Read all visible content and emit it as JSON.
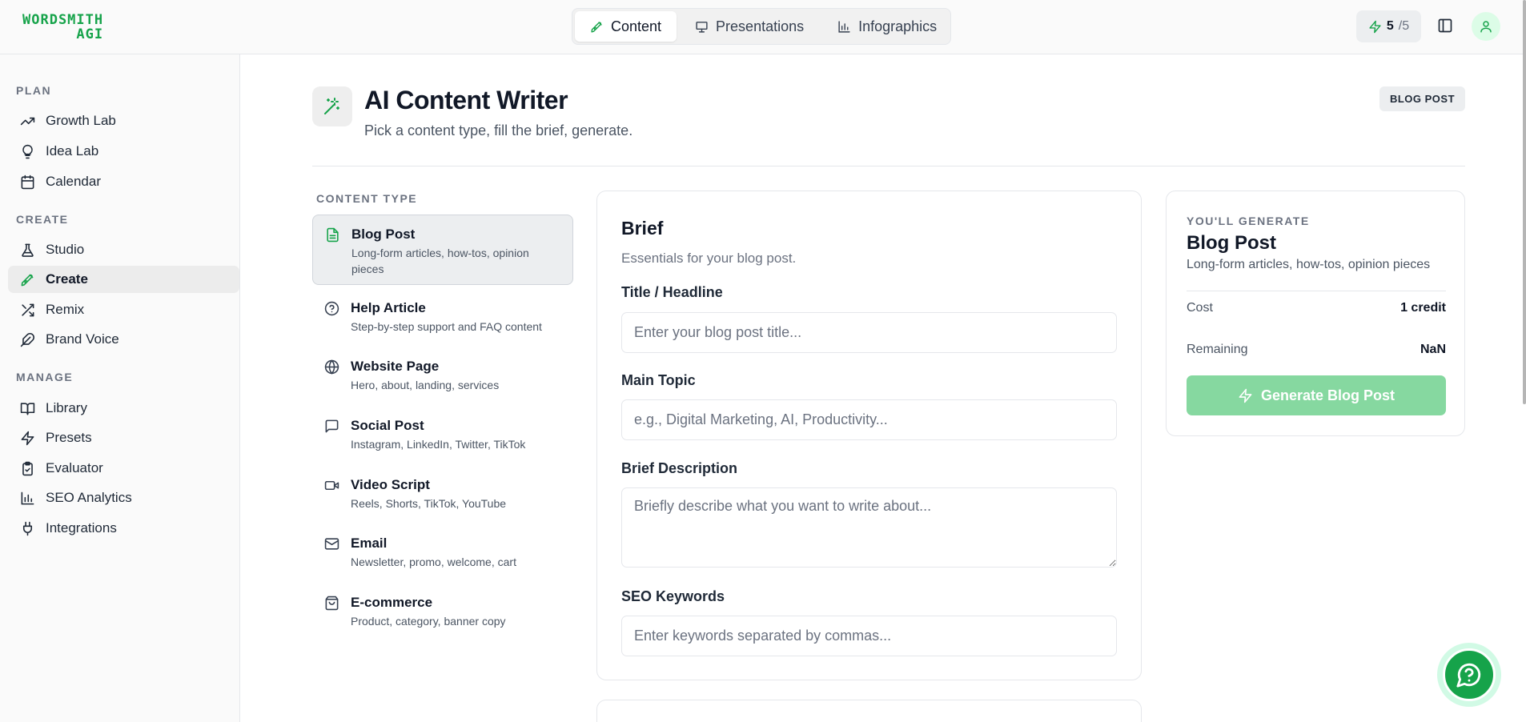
{
  "brand": {
    "line1": "WORDSMITH",
    "line2": "AGI",
    "color": "#16a34a"
  },
  "topnav": {
    "tabs": [
      {
        "label": "Content",
        "icon": "pen-nib-icon",
        "active": true
      },
      {
        "label": "Presentations",
        "icon": "presentation-icon",
        "active": false
      },
      {
        "label": "Infographics",
        "icon": "bar-chart-icon",
        "active": false
      }
    ],
    "credits": {
      "current": "5",
      "total": "/5"
    }
  },
  "sidebar": {
    "sections": [
      {
        "label": "PLAN",
        "items": [
          {
            "label": "Growth Lab",
            "icon": "trending-up-icon"
          },
          {
            "label": "Idea Lab",
            "icon": "lightbulb-icon"
          },
          {
            "label": "Calendar",
            "icon": "calendar-icon"
          }
        ]
      },
      {
        "label": "CREATE",
        "items": [
          {
            "label": "Studio",
            "icon": "flask-icon"
          },
          {
            "label": "Create",
            "icon": "pen-nib-icon",
            "active": true
          },
          {
            "label": "Remix",
            "icon": "shuffle-icon"
          },
          {
            "label": "Brand Voice",
            "icon": "feather-icon"
          }
        ]
      },
      {
        "label": "MANAGE",
        "items": [
          {
            "label": "Library",
            "icon": "book-open-icon"
          },
          {
            "label": "Presets",
            "icon": "zap-icon"
          },
          {
            "label": "Evaluator",
            "icon": "clipboard-check-icon"
          },
          {
            "label": "SEO Analytics",
            "icon": "bar-chart-icon"
          },
          {
            "label": "Integrations",
            "icon": "plug-icon"
          }
        ]
      }
    ]
  },
  "header": {
    "title": "AI Content Writer",
    "subtitle": "Pick a content type, fill the brief, generate.",
    "badge": "BLOG POST"
  },
  "content_types": {
    "label": "CONTENT TYPE",
    "items": [
      {
        "name": "Blog Post",
        "desc": "Long-form articles, how-tos, opinion pieces",
        "icon": "file-text-icon",
        "active": true
      },
      {
        "name": "Help Article",
        "desc": "Step-by-step support and FAQ content",
        "icon": "help-circle-icon"
      },
      {
        "name": "Website Page",
        "desc": "Hero, about, landing, services",
        "icon": "globe-icon"
      },
      {
        "name": "Social Post",
        "desc": "Instagram, LinkedIn, Twitter, TikTok",
        "icon": "message-square-icon"
      },
      {
        "name": "Video Script",
        "desc": "Reels, Shorts, TikTok, YouTube",
        "icon": "video-icon"
      },
      {
        "name": "Email",
        "desc": "Newsletter, promo, welcome, cart",
        "icon": "mail-icon"
      },
      {
        "name": "E-commerce",
        "desc": "Product, category, banner copy",
        "icon": "shopping-bag-icon"
      }
    ]
  },
  "brief": {
    "title": "Brief",
    "subtitle": "Essentials for your blog post.",
    "fields": {
      "title": {
        "label": "Title / Headline",
        "placeholder": "Enter your blog post title...",
        "value": ""
      },
      "topic": {
        "label": "Main Topic",
        "placeholder": "e.g., Digital Marketing, AI, Productivity...",
        "value": ""
      },
      "description": {
        "label": "Brief Description",
        "placeholder": "Briefly describe what you want to write about...",
        "value": ""
      },
      "keywords": {
        "label": "SEO Keywords",
        "placeholder": "Enter keywords separated by commas...",
        "value": ""
      }
    }
  },
  "summary": {
    "label": "YOU'LL GENERATE",
    "title": "Blog Post",
    "desc": "Long-form articles, how-tos, opinion pieces",
    "cost_label": "Cost",
    "cost_value": "1 credit",
    "remaining_label": "Remaining",
    "remaining_value": "NaN",
    "button_label": "Generate Blog Post"
  },
  "colors": {
    "accent": "#16a34a",
    "button_disabled": "#86d8a0",
    "active_bg": "#eceef0"
  }
}
